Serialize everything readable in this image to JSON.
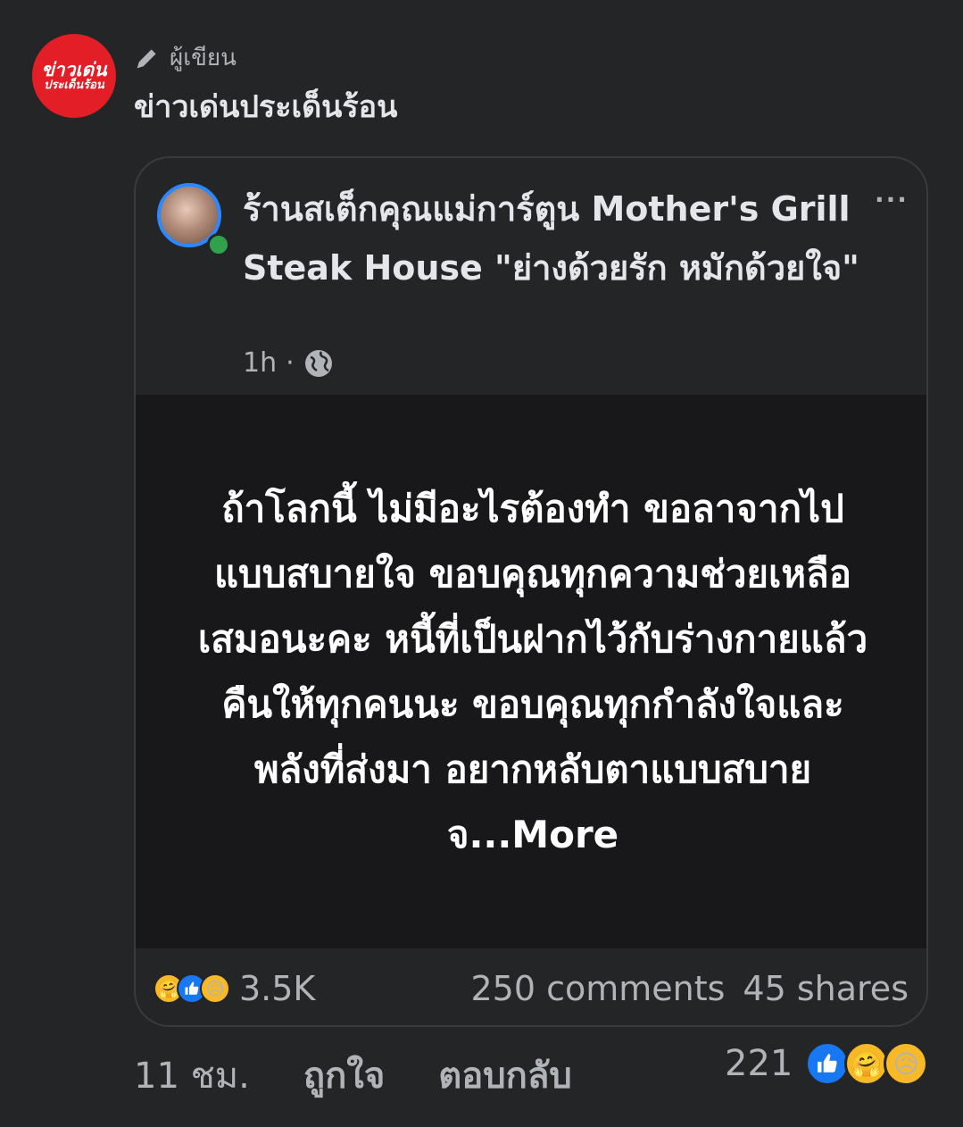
{
  "author": {
    "avatar_line1": "ข่าวเด่น",
    "avatar_line2": "ประเด็นร้อน",
    "role_label": "ผู้เขียน",
    "name": "ข่าวเด่นประเด็นร้อน"
  },
  "shared_post": {
    "page_name": "ร้านสเต็กคุณแม่การ์ตูน Mother's Grill Steak House \"ย่างด้วยรัก หมักด้วยใจ\"",
    "time": "1h",
    "separator": "·",
    "more_menu": "···",
    "body_text": "ถ้าโลกนี้ ไม่มีอะไรต้องทำ ขอลาจากไปแบบสบายใจ ขอบคุณทุกความช่วยเหลือเสมอนะคะ หนี้ที่เป็นฝากไว้กับร่างกายแล้วคืนให้ทุกคนนะ ขอบคุณทุกกำลังใจและพลังที่ส่งมา อยากหลับตาแบบสบายจ",
    "more_link": "...More",
    "reaction_count": "3.5K",
    "comments": "250 comments",
    "shares": "45 shares",
    "reactions": [
      "care-icon",
      "like-icon",
      "sad-icon"
    ]
  },
  "comment_actions": {
    "time": "11 ชม.",
    "like": "ถูกใจ",
    "reply": "ตอบกลับ",
    "reaction_count": "221",
    "reactions": [
      "like-icon",
      "care-icon",
      "sad-icon"
    ]
  },
  "colors": {
    "background": "#242526",
    "body_bg": "#18181a",
    "accent_blue": "#1877f2",
    "brand_red": "#e41e26",
    "secondary_text": "#b0b3b8"
  }
}
